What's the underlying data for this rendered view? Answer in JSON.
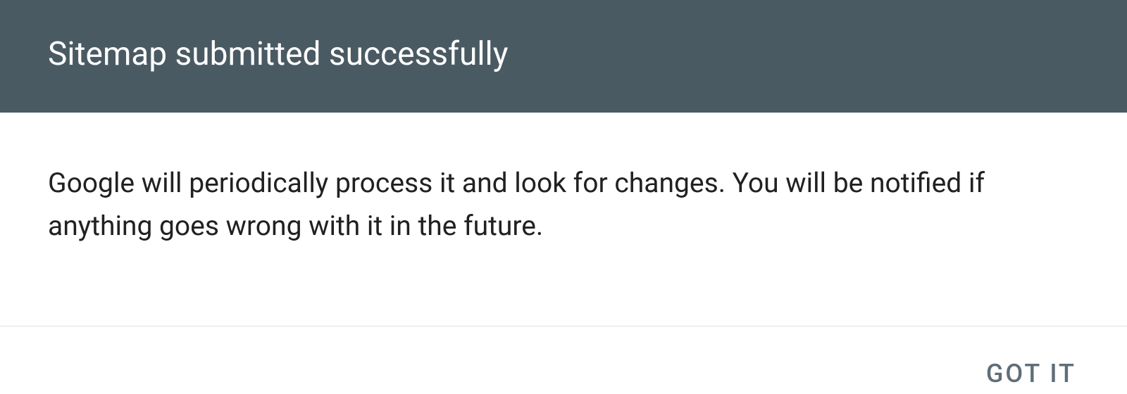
{
  "dialog": {
    "title": "Sitemap submitted successfully",
    "message": "Google will periodically process it and look for changes. You will be notified if anything goes wrong with it in the future.",
    "actions": {
      "confirm_label": "GOT IT"
    }
  },
  "colors": {
    "header_bg": "#4a5a63",
    "header_text": "#ffffff",
    "body_text": "#212121",
    "button_text": "#5f6e77",
    "divider": "#e0e0e0"
  }
}
